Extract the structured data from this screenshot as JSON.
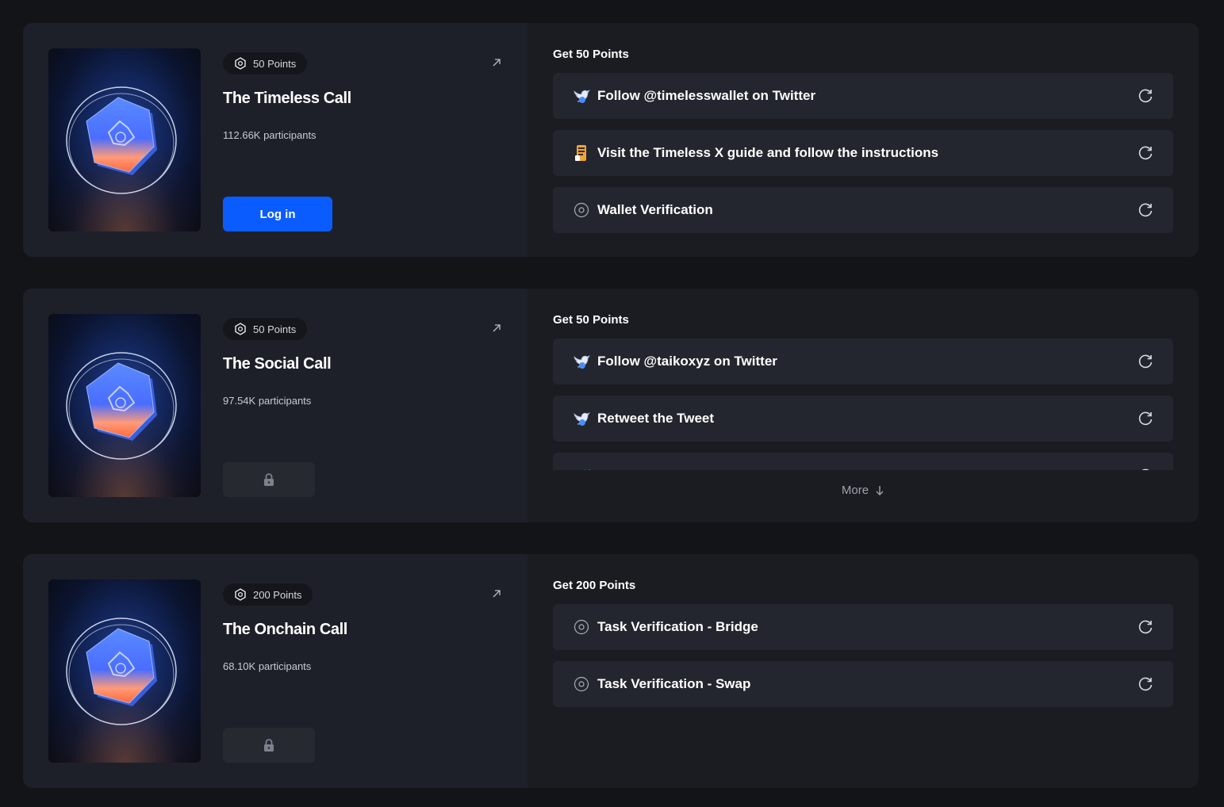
{
  "cards": [
    {
      "points_badge": "50 Points",
      "title": "The Timeless Call",
      "participants": "112.66K participants",
      "action": "login",
      "login_label": "Log in",
      "section_title": "Get 50 Points",
      "tasks": [
        {
          "icon": "twitter-bird-icon",
          "label": "Follow @timelesswallet on Twitter"
        },
        {
          "icon": "guide-document-icon",
          "label": "Visit the Timeless X guide and follow the instructions"
        },
        {
          "icon": "verification-icon",
          "label": "Wallet Verification"
        }
      ]
    },
    {
      "points_badge": "50 Points",
      "title": "The Social Call",
      "participants": "97.54K participants",
      "action": "locked",
      "section_title": "Get 50 Points",
      "tasks": [
        {
          "icon": "twitter-bird-icon",
          "label": "Follow @taikoxyz on Twitter"
        },
        {
          "icon": "twitter-bird-icon",
          "label": "Retweet the Tweet"
        }
      ],
      "more_label": "More"
    },
    {
      "points_badge": "200 Points",
      "title": "The Onchain Call",
      "participants": "68.10K participants",
      "action": "locked",
      "section_title": "Get 200 Points",
      "tasks": [
        {
          "icon": "verification-icon",
          "label": "Task Verification - Bridge"
        },
        {
          "icon": "verification-icon",
          "label": "Task Verification - Swap"
        }
      ]
    }
  ],
  "colors": {
    "background": "#121418",
    "card": "#1a1c22",
    "card_left": "#1e2029",
    "task_row": "#23262e",
    "primary_button": "#0a5cff",
    "locked_button": "#262930"
  }
}
